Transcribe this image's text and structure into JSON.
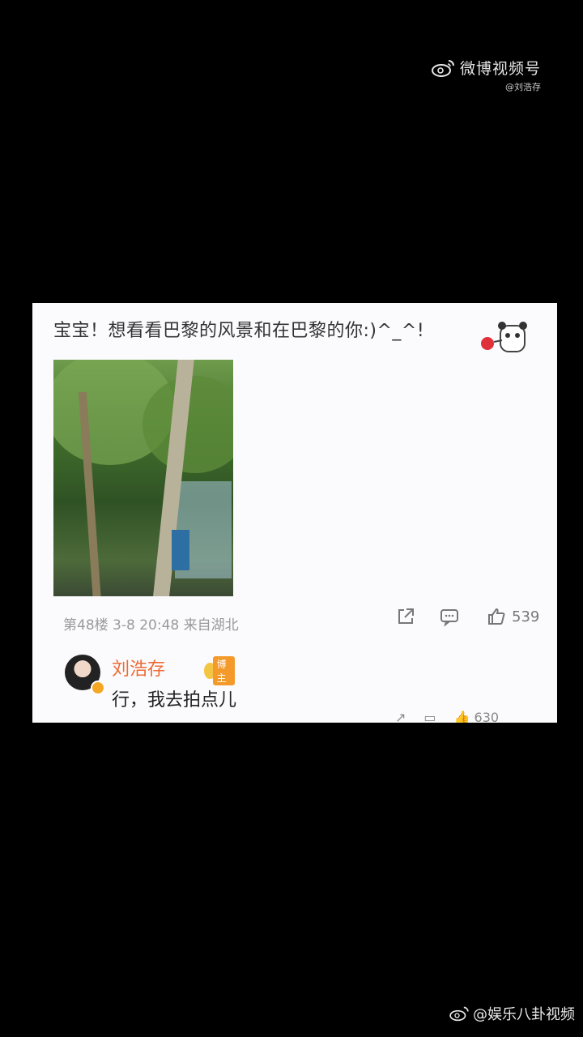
{
  "watermark_top": {
    "brand": "微博视频号",
    "handle": "@刘浩存"
  },
  "comment": {
    "text": "宝宝！想看看巴黎的风景和在巴黎的你:)^_^!",
    "meta": "第48楼 3-8 20:48 来自湖北",
    "like_count": "539"
  },
  "reply": {
    "name": "刘浩存",
    "badge": "博主",
    "text": "行，我去拍点儿",
    "like_count": "630"
  },
  "watermark_bottom": {
    "text": "@娱乐八卦视频"
  }
}
